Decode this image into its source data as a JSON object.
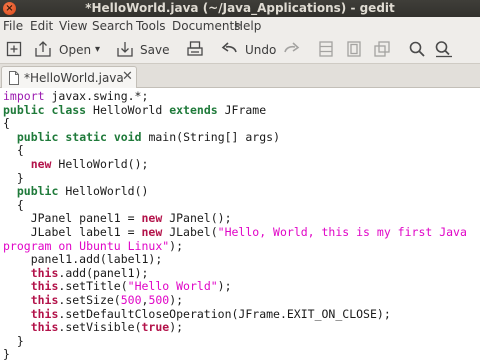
{
  "window": {
    "title": "*HelloWorld.java (~/Java_Applications) - gedit",
    "close_glyph": "×"
  },
  "menu": {
    "items": [
      "File",
      "Edit",
      "View",
      "Search",
      "Tools",
      "Documents",
      "Help"
    ]
  },
  "toolbar": {
    "new_icon": "new-document-icon",
    "open_label": "Open",
    "open_dropdown_glyph": "▾",
    "save_label": "Save",
    "print_icon": "print-icon",
    "undo_label": "Undo",
    "redo_icon": "redo-arrow-icon",
    "cut_icon": "cut-icon",
    "copy_icon": "copy-icon",
    "paste_icon": "paste-icon",
    "find_icon": "search-icon",
    "replace_icon": "find-replace-icon"
  },
  "tab": {
    "label": "*HelloWorld.java",
    "close_glyph": "✕"
  },
  "colors": {
    "keyword_import": "#9b1bb0",
    "keyword": "#1f7a3a",
    "keyword_new": "#b3134a",
    "string": "#e005c7",
    "number": "#e005c7"
  },
  "code": [
    [
      {
        "t": "import",
        "c": "kw-import"
      },
      {
        "t": " javax.swing.*;"
      }
    ],
    [
      {
        "t": "public",
        "c": "kw"
      },
      {
        "t": " "
      },
      {
        "t": "class",
        "c": "kw"
      },
      {
        "t": " HelloWorld "
      },
      {
        "t": "extends",
        "c": "kw"
      },
      {
        "t": " JFrame"
      }
    ],
    [
      {
        "t": "{"
      }
    ],
    [
      {
        "t": "  "
      },
      {
        "t": "public",
        "c": "kw"
      },
      {
        "t": " "
      },
      {
        "t": "static",
        "c": "kw"
      },
      {
        "t": " "
      },
      {
        "t": "void",
        "c": "kw"
      },
      {
        "t": " main(String[] args)"
      }
    ],
    [
      {
        "t": "  {"
      }
    ],
    [
      {
        "t": "    "
      },
      {
        "t": "new",
        "c": "kw-new"
      },
      {
        "t": " HelloWorld();"
      }
    ],
    [
      {
        "t": "  }"
      }
    ],
    [
      {
        "t": "  "
      },
      {
        "t": "public",
        "c": "kw"
      },
      {
        "t": " HelloWorld()"
      }
    ],
    [
      {
        "t": "  {"
      }
    ],
    [
      {
        "t": "    JPanel panel1 = "
      },
      {
        "t": "new",
        "c": "kw-new"
      },
      {
        "t": " JPanel();"
      }
    ],
    [
      {
        "t": "    JLabel label1 = "
      },
      {
        "t": "new",
        "c": "kw-new"
      },
      {
        "t": " JLabel("
      },
      {
        "t": "\"Hello, World, this is my first Java",
        "c": "str"
      }
    ],
    [
      {
        "t": "program on Ubuntu Linux\"",
        "c": "str"
      },
      {
        "t": ");"
      }
    ],
    [
      {
        "t": "    panel1.add(label1);"
      }
    ],
    [
      {
        "t": "    "
      },
      {
        "t": "this",
        "c": "kw-new"
      },
      {
        "t": ".add(panel1);"
      }
    ],
    [
      {
        "t": "    "
      },
      {
        "t": "this",
        "c": "kw-new"
      },
      {
        "t": ".setTitle("
      },
      {
        "t": "\"Hello World\"",
        "c": "str"
      },
      {
        "t": ");"
      }
    ],
    [
      {
        "t": "    "
      },
      {
        "t": "this",
        "c": "kw-new"
      },
      {
        "t": ".setSize("
      },
      {
        "t": "500",
        "c": "num"
      },
      {
        "t": ","
      },
      {
        "t": "500",
        "c": "num"
      },
      {
        "t": ");"
      }
    ],
    [
      {
        "t": "    "
      },
      {
        "t": "this",
        "c": "kw-new"
      },
      {
        "t": ".setDefaultCloseOperation(JFrame.EXIT_ON_CLOSE);"
      }
    ],
    [
      {
        "t": "    "
      },
      {
        "t": "this",
        "c": "kw-new"
      },
      {
        "t": ".setVisible("
      },
      {
        "t": "true",
        "c": "kw-new"
      },
      {
        "t": ");"
      }
    ],
    [
      {
        "t": "  }"
      }
    ],
    [
      {
        "t": "}"
      }
    ]
  ]
}
